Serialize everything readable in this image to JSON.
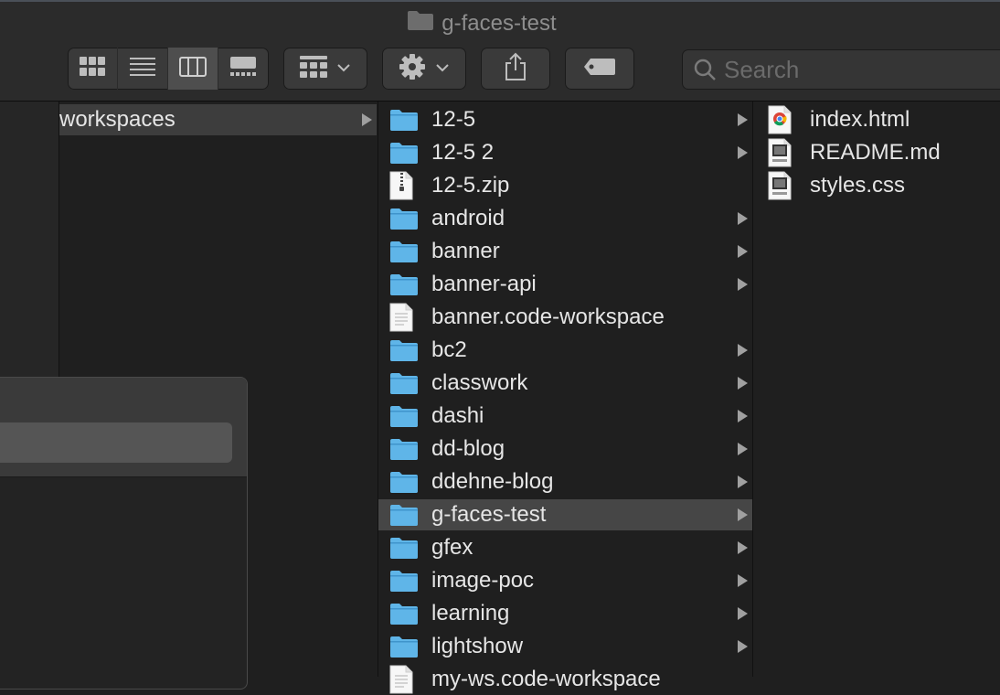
{
  "window": {
    "title": "g-faces-test",
    "title_icon": "folder-icon"
  },
  "toolbar": {
    "view_buttons": [
      {
        "name": "icon-view",
        "icon": "grid-icon"
      },
      {
        "name": "list-view",
        "icon": "list-icon"
      },
      {
        "name": "column-view",
        "icon": "columns-icon",
        "active": true
      },
      {
        "name": "gallery-view",
        "icon": "gallery-icon"
      }
    ],
    "group_icon": "group-icon",
    "action_icon": "gear-icon",
    "share_icon": "share-icon",
    "tag_icon": "tag-icon",
    "search_placeholder": "Search"
  },
  "column2": {
    "items": [
      {
        "label": "workspaces",
        "has_children": true,
        "selected": true
      }
    ]
  },
  "column3": {
    "items": [
      {
        "label": "12-5",
        "type": "folder",
        "has_children": true
      },
      {
        "label": "12-5 2",
        "type": "folder",
        "has_children": true
      },
      {
        "label": "12-5.zip",
        "type": "zip",
        "has_children": false
      },
      {
        "label": "android",
        "type": "folder",
        "has_children": true
      },
      {
        "label": "banner",
        "type": "folder",
        "has_children": true
      },
      {
        "label": "banner-api",
        "type": "folder",
        "has_children": true
      },
      {
        "label": "banner.code-workspace",
        "type": "document",
        "has_children": false
      },
      {
        "label": "bc2",
        "type": "folder",
        "has_children": true
      },
      {
        "label": "classwork",
        "type": "folder",
        "has_children": true
      },
      {
        "label": "dashi",
        "type": "folder",
        "has_children": true
      },
      {
        "label": "dd-blog",
        "type": "folder",
        "has_children": true
      },
      {
        "label": "ddehne-blog",
        "type": "folder",
        "has_children": true
      },
      {
        "label": "g-faces-test",
        "type": "folder",
        "has_children": true,
        "selected": true
      },
      {
        "label": "gfex",
        "type": "folder",
        "has_children": true
      },
      {
        "label": "image-poc",
        "type": "folder",
        "has_children": true
      },
      {
        "label": "learning",
        "type": "folder",
        "has_children": true
      },
      {
        "label": "lightshow",
        "type": "folder",
        "has_children": true
      },
      {
        "label": "my-ws.code-workspace",
        "type": "document",
        "has_children": false
      }
    ]
  },
  "column4": {
    "items": [
      {
        "label": "index.html",
        "type": "chrome-html"
      },
      {
        "label": "README.md",
        "type": "markdown"
      },
      {
        "label": "styles.css",
        "type": "css"
      }
    ]
  },
  "colors": {
    "folder": "#5fb5e8",
    "selection": "#464646",
    "background": "#1f1f1f"
  }
}
